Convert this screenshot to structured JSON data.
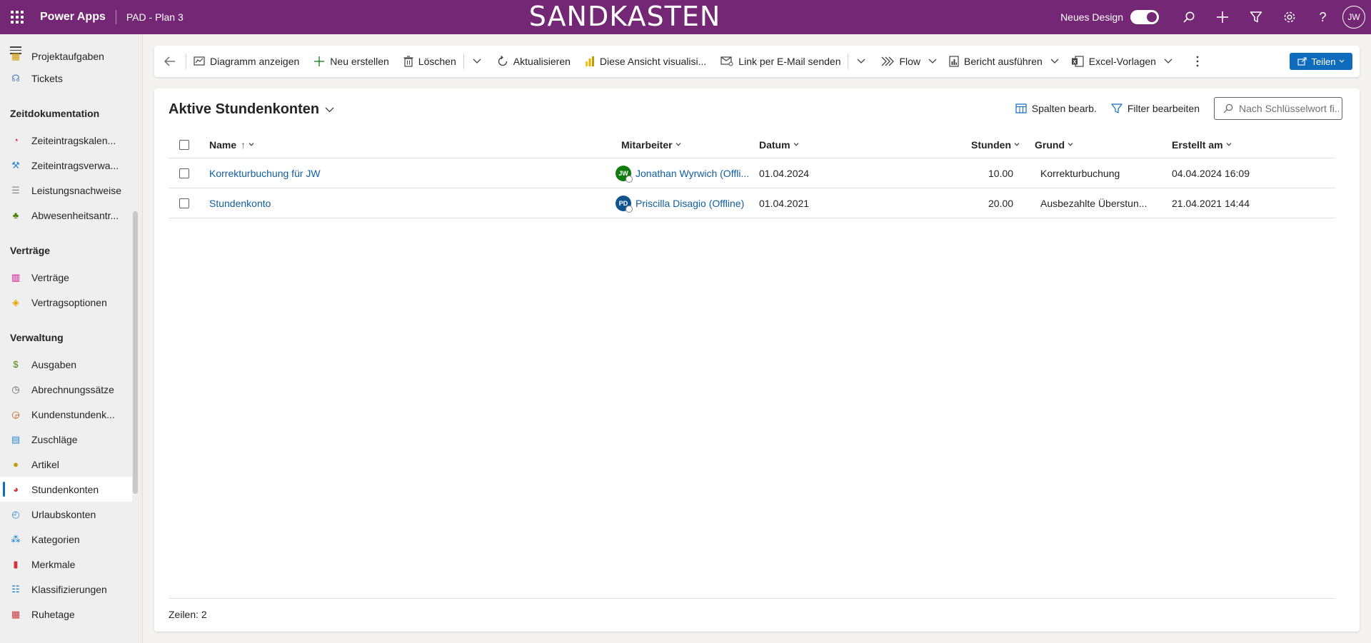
{
  "topbar": {
    "app_name": "Power Apps",
    "env_name": "PAD - Plan 3",
    "banner": "SANDKASTEN",
    "new_design_label": "Neues Design",
    "user_initials": "JW"
  },
  "sidebar": {
    "items": [
      {
        "label": "Projektaufgaben",
        "icon": "task-icon"
      },
      {
        "label": "Tickets",
        "icon": "ticket-icon"
      }
    ],
    "sections": [
      {
        "title": "Zeitdokumentation",
        "items": [
          {
            "label": "Zeiteintragskalen...",
            "icon": "clock-icon"
          },
          {
            "label": "Zeiteintragsverwa...",
            "icon": "tools-icon"
          },
          {
            "label": "Leistungsnachweise",
            "icon": "list-icon"
          },
          {
            "label": "Abwesenheitsantr...",
            "icon": "palm-icon"
          }
        ]
      },
      {
        "title": "Verträge",
        "items": [
          {
            "label": "Verträge",
            "icon": "books-icon"
          },
          {
            "label": "Vertragsoptionen",
            "icon": "tag-icon"
          }
        ]
      },
      {
        "title": "Verwaltung",
        "items": [
          {
            "label": "Ausgaben",
            "icon": "money-icon"
          },
          {
            "label": "Abrechnungssätze",
            "icon": "timer-icon"
          },
          {
            "label": "Kundenstundenk...",
            "icon": "history-icon"
          },
          {
            "label": "Zuschläge",
            "icon": "surcharge-icon"
          },
          {
            "label": "Artikel",
            "icon": "article-icon"
          },
          {
            "label": "Stundenkonten",
            "icon": "hours-icon",
            "active": true
          },
          {
            "label": "Urlaubskonten",
            "icon": "vacation-icon"
          },
          {
            "label": "Kategorien",
            "icon": "category-icon"
          },
          {
            "label": "Merkmale",
            "icon": "feature-icon"
          },
          {
            "label": "Klassifizierungen",
            "icon": "classification-icon"
          },
          {
            "label": "Ruhetage",
            "icon": "calendar-icon"
          }
        ]
      }
    ]
  },
  "commandbar": {
    "diagram": "Diagramm anzeigen",
    "new": "Neu erstellen",
    "delete": "Löschen",
    "refresh": "Aktualisieren",
    "visualize": "Diese Ansicht visualisi...",
    "email_link": "Link per E-Mail senden",
    "flow": "Flow",
    "report": "Bericht ausführen",
    "excel": "Excel-Vorlagen",
    "share": "Teilen"
  },
  "view": {
    "title": "Aktive Stundenkonten",
    "edit_columns": "Spalten bearb.",
    "edit_filters": "Filter bearbeiten",
    "search_placeholder": "Nach Schlüsselwort fi...",
    "columns": {
      "name": "Name",
      "mitarbeiter": "Mitarbeiter",
      "datum": "Datum",
      "stunden": "Stunden",
      "grund": "Grund",
      "erstellt": "Erstellt am"
    },
    "rows": [
      {
        "name": "Korrekturbuchung für JW",
        "initials": "JW",
        "avatar_color": "#107c10",
        "mitarbeiter": "Jonathan Wyrwich (Offli...",
        "datum": "01.04.2024",
        "stunden": "10.00",
        "grund": "Korrekturbuchung",
        "erstellt": "04.04.2024 16:09"
      },
      {
        "name": "Stundenkonto",
        "initials": "PD",
        "avatar_color": "#0f548c",
        "mitarbeiter": "Priscilla Disagio (Offline)",
        "datum": "01.04.2021",
        "stunden": "20.00",
        "grund": "Ausbezahlte Überstun...",
        "erstellt": "21.04.2021 14:44"
      }
    ],
    "footer": "Zeilen: 2"
  }
}
